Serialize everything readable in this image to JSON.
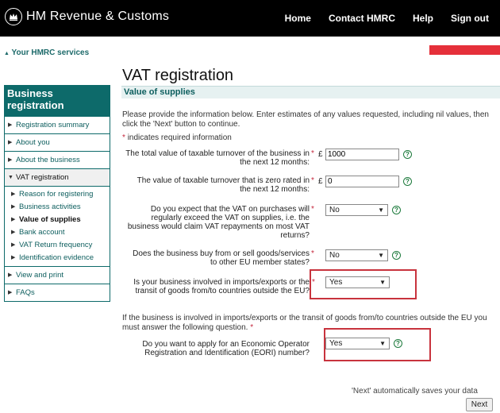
{
  "header": {
    "logo_text": "HM Revenue & Customs",
    "nav": [
      "Home",
      "Contact HMRC",
      "Help",
      "Sign out"
    ]
  },
  "services_link": "Your HMRC services",
  "sidebar": {
    "heading": "Business registration",
    "items_top": [
      "Registration summary",
      "About you",
      "About the business"
    ],
    "active_section": "VAT registration",
    "sub_items": [
      "Reason for registering",
      "Business activities",
      "Value of supplies",
      "Bank account",
      "VAT Return frequency",
      "Identification evidence"
    ],
    "current_sub": "Value of supplies",
    "items_bottom": [
      "View and print",
      "FAQs"
    ]
  },
  "page": {
    "title": "VAT registration",
    "section": "Value of supplies",
    "intro": "Please provide the information below. Enter estimates of any values requested, including nil values, then click the 'Next' button to continue.",
    "required_note": "indicates required information",
    "required_mark": "*",
    "currency": "£",
    "help_glyph": "?"
  },
  "questions": {
    "q1": {
      "label": "The total value of taxable turnover of the business in the next 12 months:",
      "value": "1000"
    },
    "q2": {
      "label": "The value of taxable turnover that is zero rated in the next 12 months:",
      "value": "0"
    },
    "q3": {
      "label": "Do you expect that the VAT on purchases will regularly exceed the VAT on supplies, i.e. the business would claim VAT repayments on most VAT returns?",
      "value": "No"
    },
    "q4": {
      "label": "Does the business buy from or sell goods/services to other EU member states?",
      "value": "No"
    },
    "q5": {
      "label": "Is your business involved in imports/exports or the transit of goods from/to countries outside the EU?",
      "value": "Yes"
    },
    "q6": {
      "label": "Do you want to apply for an Economic Operator Registration and Identification (EORI) number?",
      "value": "Yes"
    }
  },
  "eu_note": "If the business is involved in imports/exports or the transit of goods from/to countries outside the EU you must answer the following question.",
  "footer": {
    "saves_note": "'Next' automatically saves your data",
    "next_label": "Next"
  },
  "colors": {
    "brand_teal": "#0d6a6a",
    "highlight_red": "#c8333d",
    "accent_red": "#e5303a"
  },
  "icons": [
    "crown-crest-icon",
    "triangle-right-icon",
    "triangle-down-icon",
    "help-circle-icon",
    "dropdown-arrow-icon"
  ]
}
